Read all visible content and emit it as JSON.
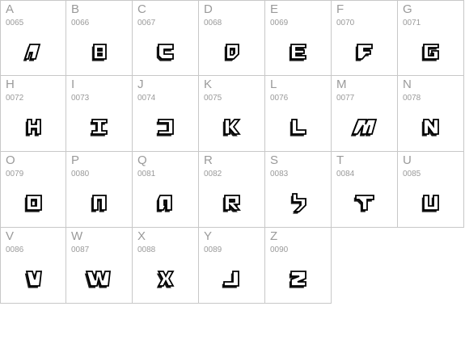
{
  "glyphs": [
    {
      "char": "A",
      "code": "0065",
      "icon": "glyph-A"
    },
    {
      "char": "B",
      "code": "0066",
      "icon": "glyph-B"
    },
    {
      "char": "C",
      "code": "0067",
      "icon": "glyph-C"
    },
    {
      "char": "D",
      "code": "0068",
      "icon": "glyph-D"
    },
    {
      "char": "E",
      "code": "0069",
      "icon": "glyph-E"
    },
    {
      "char": "F",
      "code": "0070",
      "icon": "glyph-F"
    },
    {
      "char": "G",
      "code": "0071",
      "icon": "glyph-G"
    },
    {
      "char": "H",
      "code": "0072",
      "icon": "glyph-H"
    },
    {
      "char": "I",
      "code": "0073",
      "icon": "glyph-I"
    },
    {
      "char": "J",
      "code": "0074",
      "icon": "glyph-J"
    },
    {
      "char": "K",
      "code": "0075",
      "icon": "glyph-K"
    },
    {
      "char": "L",
      "code": "0076",
      "icon": "glyph-L"
    },
    {
      "char": "M",
      "code": "0077",
      "icon": "glyph-M"
    },
    {
      "char": "N",
      "code": "0078",
      "icon": "glyph-N"
    },
    {
      "char": "O",
      "code": "0079",
      "icon": "glyph-O"
    },
    {
      "char": "P",
      "code": "0080",
      "icon": "glyph-P"
    },
    {
      "char": "Q",
      "code": "0081",
      "icon": "glyph-Q"
    },
    {
      "char": "R",
      "code": "0082",
      "icon": "glyph-R"
    },
    {
      "char": "S",
      "code": "0083",
      "icon": "glyph-S"
    },
    {
      "char": "T",
      "code": "0084",
      "icon": "glyph-T"
    },
    {
      "char": "U",
      "code": "0085",
      "icon": "glyph-U"
    },
    {
      "char": "V",
      "code": "0086",
      "icon": "glyph-V"
    },
    {
      "char": "W",
      "code": "0087",
      "icon": "glyph-W"
    },
    {
      "char": "X",
      "code": "0088",
      "icon": "glyph-X"
    },
    {
      "char": "Y",
      "code": "0089",
      "icon": "glyph-Y"
    },
    {
      "char": "Z",
      "code": "0090",
      "icon": "glyph-Z"
    }
  ]
}
